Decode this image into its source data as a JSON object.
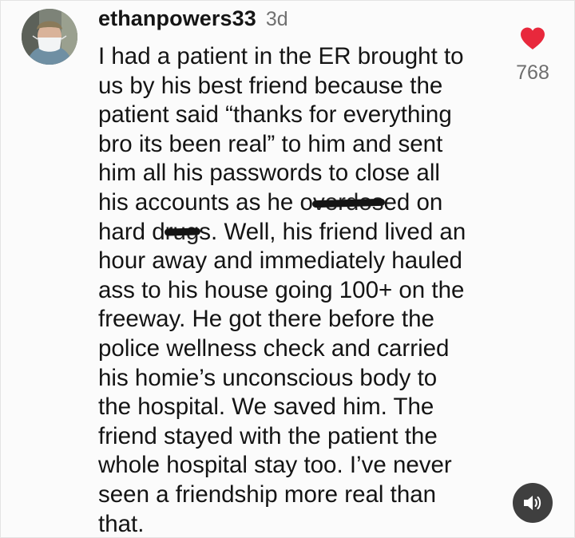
{
  "comment": {
    "username": "ethanpowers33",
    "timestamp": "3d",
    "text_part1": "I had a patient in the ER brought to\nus by his best friend because the\npatient said “thanks for everything\nbro its been real” to him and sent\nhim all his passwords to close all\nhis accounts as he o",
    "redacted_1": "verdos",
    "text_part2": "ed on\nhard d",
    "redacted_2": "rug",
    "text_part3": "s. Well, his friend lived an\nhour away and immediately hauled\nass to his house going 100+ on the\nfreeway. He got there before the\npolice wellness check and carried\nhis homie’s unconscious body to\nthe hospital. We saved him. The\nfriend stayed with the patient the\nwhole hospital stay too. I’ve never\nseen a friendship more real than\nthat.",
    "like_count": "768"
  },
  "icons": {
    "like": "heart-icon",
    "sound": "speaker-icon",
    "avatar": "profile-photo"
  },
  "colors": {
    "heart": "#e8283c",
    "sound_button": "#3f3f3f",
    "username": "#151515",
    "secondary_text": "#707070"
  }
}
